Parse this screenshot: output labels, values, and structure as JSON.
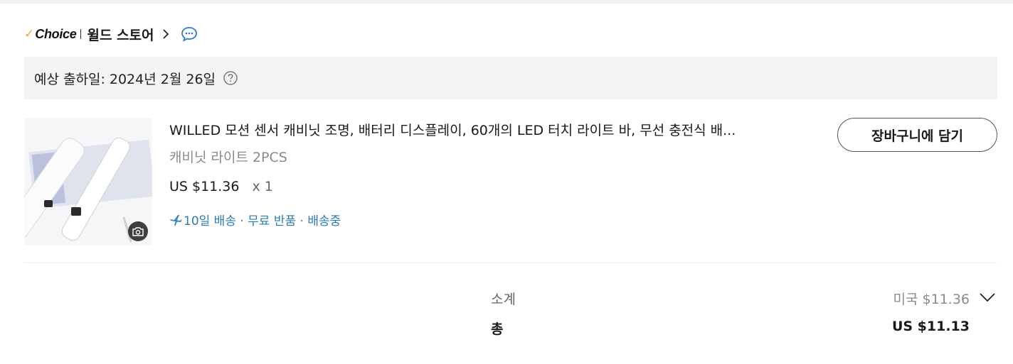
{
  "store": {
    "badge_check": "✓",
    "badge_text": "Choice",
    "name": "윌드 스토어"
  },
  "shipping": {
    "estimate_text": "예상 출하일: 2024년 2월 26일"
  },
  "item": {
    "title": "WILLED 모션 센서 캐비닛 조명, 배터리 디스플레이, 60개의 LED 터치 라이트 바, 무선 충전식 배...",
    "variant": "캐비닛 라이트 2PCS",
    "price": "US $11.36",
    "quantity": "x 1",
    "delivery": "10일 배송 · 무료 반품 · 배송중",
    "add_to_cart": "장바구니에 담기"
  },
  "summary": {
    "subtotal_label": "소계",
    "subtotal_value": "미국 $11.36",
    "total_label": "총",
    "total_value": "US $11.13"
  },
  "icons": {
    "store_chevron": "chevron-right-icon",
    "chat": "chat-icon",
    "help": "help-icon",
    "camera": "camera-icon",
    "plane": "plane-icon",
    "expand": "chevron-down-icon"
  },
  "colors": {
    "choice_check": "#f5a623",
    "chat_icon": "#2b7bd6",
    "delivery_text": "#2b7bb9",
    "ship_bar_bg": "#f4f4f4"
  }
}
